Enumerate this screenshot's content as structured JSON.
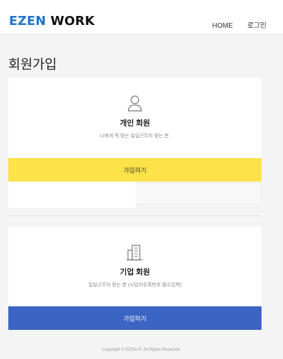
{
  "header": {
    "logo_part1": "EZEN",
    "logo_part2": "WORK",
    "nav": {
      "home": "HOME",
      "login": "로그인"
    }
  },
  "page": {
    "title": "회원가입"
  },
  "personal": {
    "title": "개인 회원",
    "description": "나에게 딱 맞는 일일근무지 찾는 분.",
    "button": "가입하기",
    "icon": "person-icon"
  },
  "company": {
    "title": "기업 회원",
    "description": "일일근무자 찾는 분 (사업자등록번호 필수입력)",
    "button": "가입하기",
    "icon": "building-icon"
  },
  "footer": {
    "copyright": "Copyright © EZEN-IT. All Rights Reserved."
  },
  "colors": {
    "brand_blue": "#1f74c8",
    "personal_button": "#fde24a",
    "company_button": "#3c64c4",
    "background": "#f4f4f4"
  }
}
